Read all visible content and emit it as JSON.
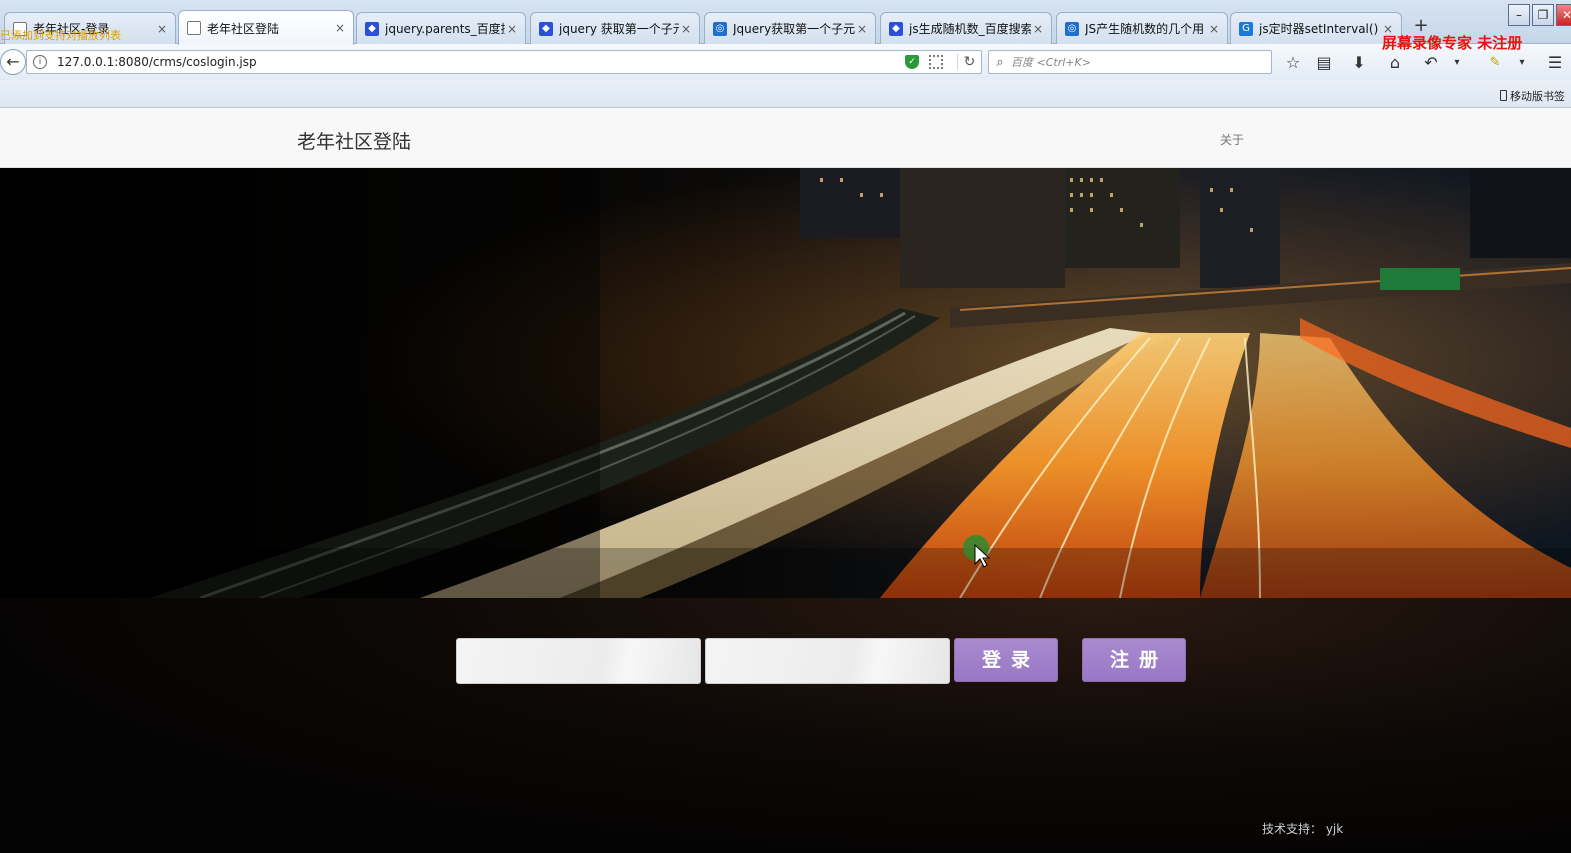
{
  "browser": {
    "tabs": [
      {
        "label": "老年社区-登录",
        "icon": "page-icon",
        "active": false
      },
      {
        "label": "老年社区登陆",
        "icon": "page-icon",
        "active": true
      },
      {
        "label": "jquery.parents_百度搜",
        "icon": "baidu-icon",
        "active": false
      },
      {
        "label": "jquery 获取第一个子元",
        "icon": "baidu-icon",
        "active": false
      },
      {
        "label": "Jquery获取第一个子元",
        "icon": "so-icon",
        "active": false
      },
      {
        "label": "js生成随机数_百度搜索",
        "icon": "baidu-icon",
        "active": false
      },
      {
        "label": "JS产生随机数的几个用",
        "icon": "so-icon",
        "active": false
      },
      {
        "label": "js定时器setInterval()",
        "icon": "g-icon",
        "active": false
      }
    ],
    "tab_close_glyph": "×",
    "new_tab_glyph": "+",
    "url": "127.0.0.1:8080/crms/coslogin.jsp",
    "search_placeholder": "百度 <Ctrl+K>",
    "mobile_bookmarks": "移动版书签",
    "watermark_left": "已添加到支持对播放列表",
    "watermark_right": "屏幕录像专家  未注册"
  },
  "site": {
    "brand": "老年社区登陆",
    "about": "关于",
    "username_value": "",
    "password_value": "",
    "login_label": "登录",
    "register_label": "注册",
    "credit": "技术支持： yjk"
  },
  "colors": {
    "button_purple": "#9f80c9",
    "header_bg": "#f8f8f8"
  }
}
